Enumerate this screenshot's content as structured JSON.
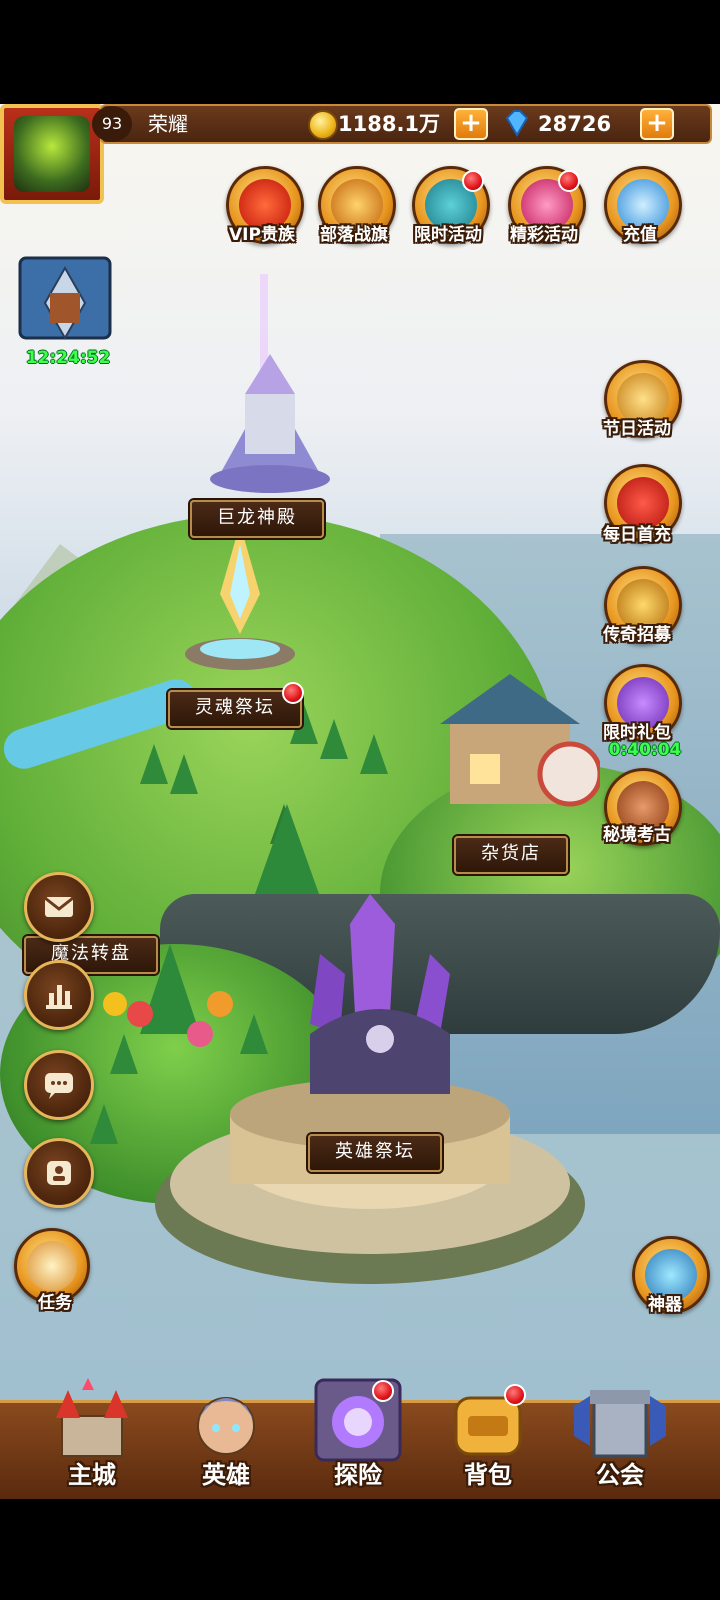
{
  "player": {
    "level": "93",
    "name": "荣耀"
  },
  "currency": {
    "gold": "1188.1万",
    "diamonds": "28726"
  },
  "timers": {
    "chest": "12:24:52",
    "gift": "0:40:04"
  },
  "top_menu": [
    {
      "label": "VIP贵族",
      "icon": "crown-icon",
      "badge": false
    },
    {
      "label": "部落战旗",
      "icon": "banner-icon",
      "badge": false
    },
    {
      "label": "限时活动",
      "icon": "hourglass-icon",
      "badge": true
    },
    {
      "label": "精彩活动",
      "icon": "scroll-icon",
      "badge": true
    },
    {
      "label": "充值",
      "icon": "gem-icon",
      "badge": false
    }
  ],
  "right_menu": [
    {
      "label": "节日活动",
      "icon": "treasure-icon"
    },
    {
      "label": "每日首充",
      "icon": "giftbox-icon"
    },
    {
      "label": "传奇招募",
      "icon": "trophy-icon"
    },
    {
      "label": "限时礼包",
      "icon": "gift-clock-icon"
    },
    {
      "label": "秘境考古",
      "icon": "mask-icon"
    },
    {
      "label": "神器",
      "icon": "artifact-icon"
    }
  ],
  "buildings": {
    "dragon_temple": "巨龙神殿",
    "soul_altar": "灵魂祭坛",
    "general_store": "杂货店",
    "magic_wheel": "魔法转盘",
    "hero_altar": "英雄祭坛"
  },
  "left_menu": {
    "quest_label": "任务",
    "icons": [
      "mail-icon",
      "ranking-icon",
      "chat-icon",
      "contacts-icon"
    ]
  },
  "bottom_nav": [
    {
      "label": "主城",
      "icon": "castle-icon",
      "badge": false
    },
    {
      "label": "英雄",
      "icon": "hero-icon",
      "badge": false
    },
    {
      "label": "探险",
      "icon": "portal-icon",
      "badge": true
    },
    {
      "label": "背包",
      "icon": "backpack-icon",
      "badge": true
    },
    {
      "label": "公会",
      "icon": "guild-icon",
      "badge": false
    }
  ],
  "colors": {
    "frame_gold": "#c8893b",
    "badge_red": "#e0141a",
    "timer_green": "#3cff4a"
  }
}
